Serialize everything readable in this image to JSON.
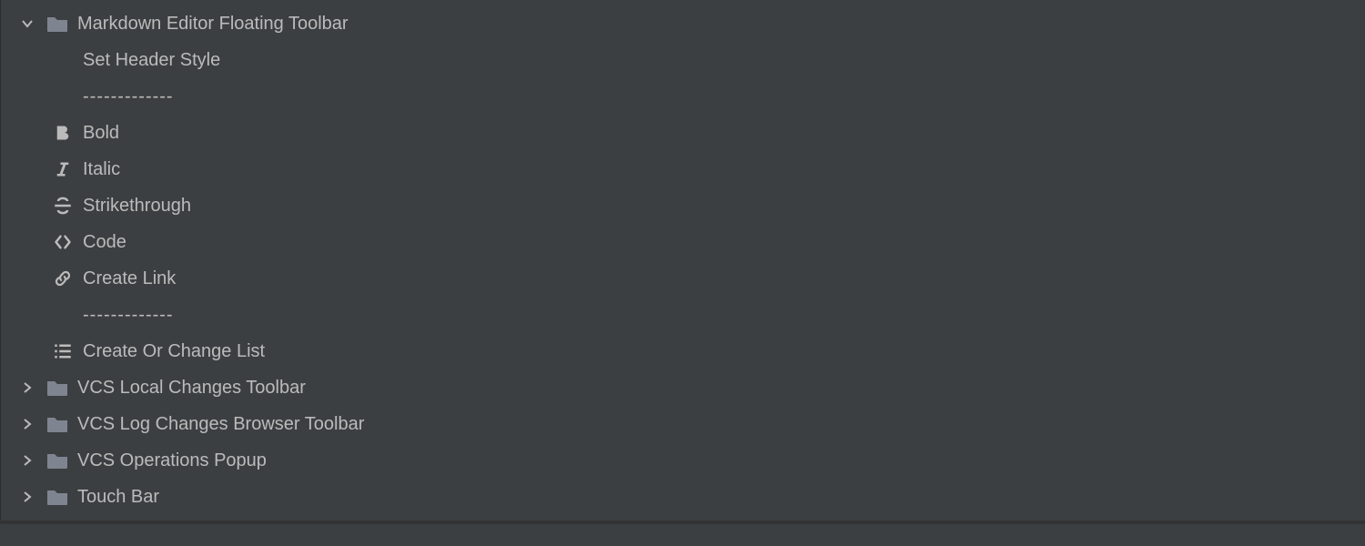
{
  "tree": {
    "markdown_toolbar": {
      "label": "Markdown Editor Floating Toolbar",
      "children": {
        "set_header": "Set Header Style",
        "sep1": "-------------",
        "bold": "Bold",
        "italic": "Italic",
        "strike": "Strikethrough",
        "code": "Code",
        "link": "Create Link",
        "sep2": "-------------",
        "list": "Create Or Change List"
      }
    },
    "vcs_local": {
      "label": "VCS Local Changes Toolbar"
    },
    "vcs_log": {
      "label": "VCS Log Changes Browser Toolbar"
    },
    "vcs_ops": {
      "label": "VCS Operations Popup"
    },
    "touch_bar": {
      "label": "Touch Bar"
    }
  }
}
